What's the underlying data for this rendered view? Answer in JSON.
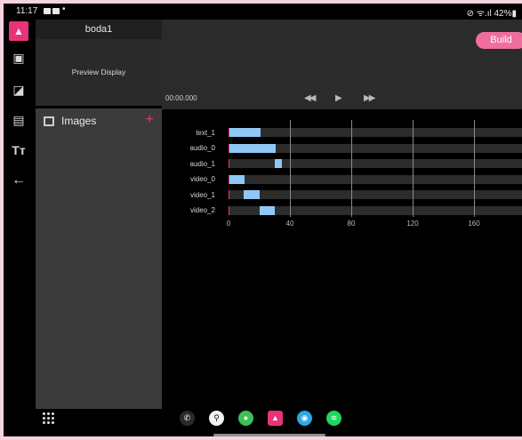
{
  "status_bar": {
    "time": "11:17",
    "dot": "•",
    "right": "⊘ ᯤ.ıl 42%▮"
  },
  "project": {
    "name": "boda1"
  },
  "preview": {
    "label": "Preview Display"
  },
  "assets": {
    "title": "Images",
    "add_symbol": "+"
  },
  "toolbar": {
    "build_label": "Build",
    "timecode": "00:00.000",
    "rewind_icon": "◀◀",
    "play_icon": "▶",
    "forward_icon": "▶▶"
  },
  "timeline": {
    "x_ticks": [
      "0",
      "40",
      "80",
      "120",
      "160"
    ],
    "tracks": [
      {
        "label": "text_1",
        "clip_start": 0,
        "clip_end": 20
      },
      {
        "label": "audio_0",
        "clip_start": 0,
        "clip_end": 30
      },
      {
        "label": "audio_1",
        "clip_start": 30,
        "clip_end": 35
      },
      {
        "label": "video_0",
        "clip_start": 0,
        "clip_end": 10
      },
      {
        "label": "video_1",
        "clip_start": 10,
        "clip_end": 20
      },
      {
        "label": "video_2",
        "clip_start": 20,
        "clip_end": 30
      }
    ]
  },
  "dock": {
    "apps": [
      {
        "name": "phone-app",
        "glyph": "✆",
        "color": "#2a2a2a"
      },
      {
        "name": "maps-app",
        "glyph": "⚲",
        "color": "#f2f2f2"
      },
      {
        "name": "messages-app",
        "glyph": "●",
        "color": "#3fbf5a"
      },
      {
        "name": "editor-app",
        "glyph": "▲",
        "color": "#e8337a"
      },
      {
        "name": "browser-app",
        "glyph": "◉",
        "color": "#2fa7e6"
      },
      {
        "name": "spotify-app",
        "glyph": "≋",
        "color": "#1ed760"
      }
    ]
  }
}
